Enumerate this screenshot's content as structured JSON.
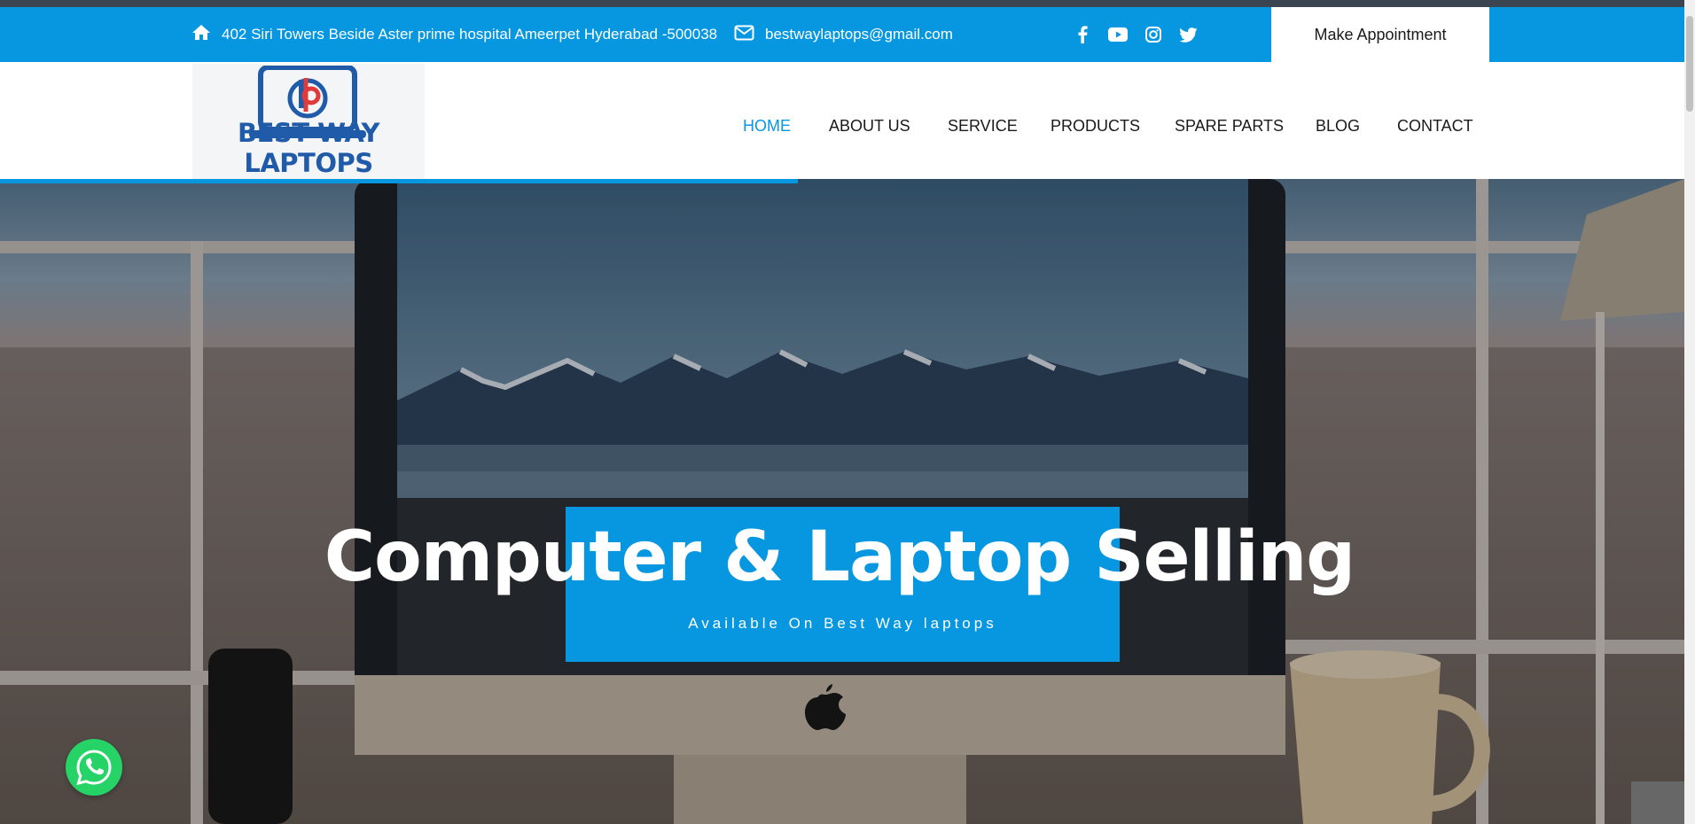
{
  "topbar": {
    "address": "402 Siri Towers Beside Aster prime hospital Ameerpet Hyderabad -500038",
    "email": "bestwaylaptops@gmail.com",
    "social": [
      "facebook-icon",
      "youtube-icon",
      "instagram-icon",
      "twitter-icon"
    ],
    "appointment_label": "Make Appointment"
  },
  "header": {
    "logo_text": "BEST WAY LAPTOPS",
    "nav": [
      {
        "label": "HOME",
        "active": true
      },
      {
        "label": "ABOUT US",
        "active": false
      },
      {
        "label": "SERVICE",
        "active": false
      },
      {
        "label": "PRODUCTS",
        "active": false
      },
      {
        "label": "SPARE PARTS",
        "active": false
      },
      {
        "label": "BLOG",
        "active": false
      },
      {
        "label": "CONTACT",
        "active": false
      }
    ]
  },
  "hero": {
    "title": "Computer & Laptop Selling",
    "subtitle": "Available On Best Way laptops"
  },
  "colors": {
    "accent": "#0797e0",
    "logo_blue": "#1f5ba8",
    "logo_red": "#e03a3a",
    "whatsapp": "#25d366"
  }
}
